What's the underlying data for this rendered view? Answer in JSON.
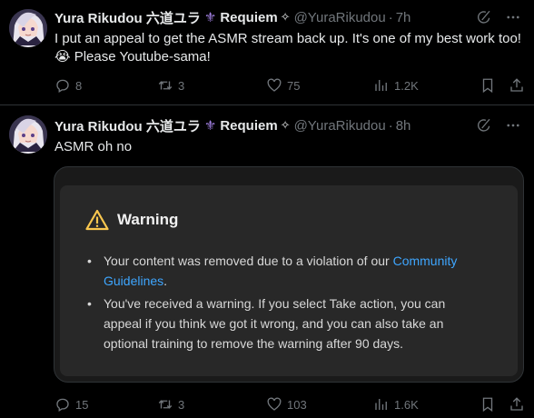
{
  "tweets": [
    {
      "author": {
        "display_name": "Yura Rikudou 六道ユラ",
        "name_suffix": "Requiem",
        "handle": "@YuraRikudou",
        "separator": "·",
        "time": "7h"
      },
      "text": "I put an appeal to get the ASMR stream back up. It's one of my best work too! 😭 Please Youtube-sama!",
      "stats": {
        "replies": "8",
        "retweets": "3",
        "likes": "75",
        "views": "1.2K"
      }
    },
    {
      "author": {
        "display_name": "Yura Rikudou 六道ユラ",
        "name_suffix": "Requiem",
        "handle": "@YuraRikudou",
        "separator": "·",
        "time": "8h"
      },
      "text": "ASMR oh no",
      "media": {
        "warning_title": "Warning",
        "bullet_1_prefix": "Your content was removed due to a violation of our ",
        "bullet_1_link_1": "Community",
        "bullet_1_link_2": "Guidelines",
        "bullet_1_suffix": ".",
        "bullet_2": "You've received a warning. If you select Take action, you can appeal if you think we got it wrong, and you can also take an optional training to remove the warning after 90 days."
      },
      "stats": {
        "replies": "15",
        "retweets": "3",
        "likes": "103",
        "views": "1.6K"
      }
    }
  ],
  "icons": {
    "fleur": "⚜",
    "sparkle": "✧"
  },
  "colors": {
    "background": "#000000",
    "text": "#e7e9ea",
    "muted": "#71767b",
    "divider": "#2f3336",
    "link": "#3ea6ff",
    "warning_yellow": "#f9c74f",
    "fleur_purple": "#a07fe0"
  }
}
